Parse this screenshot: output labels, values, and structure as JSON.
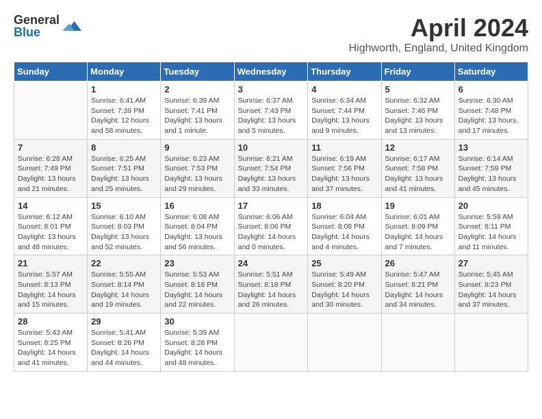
{
  "logo": {
    "general": "General",
    "blue": "Blue"
  },
  "title": "April 2024",
  "location": "Highworth, England, United Kingdom",
  "days_of_week": [
    "Sunday",
    "Monday",
    "Tuesday",
    "Wednesday",
    "Thursday",
    "Friday",
    "Saturday"
  ],
  "weeks": [
    [
      {
        "day": "",
        "sunrise": "",
        "sunset": "",
        "daylight": ""
      },
      {
        "day": "1",
        "sunrise": "Sunrise: 6:41 AM",
        "sunset": "Sunset: 7:39 PM",
        "daylight": "Daylight: 12 hours and 58 minutes."
      },
      {
        "day": "2",
        "sunrise": "Sunrise: 6:39 AM",
        "sunset": "Sunset: 7:41 PM",
        "daylight": "Daylight: 13 hours and 1 minute."
      },
      {
        "day": "3",
        "sunrise": "Sunrise: 6:37 AM",
        "sunset": "Sunset: 7:43 PM",
        "daylight": "Daylight: 13 hours and 5 minutes."
      },
      {
        "day": "4",
        "sunrise": "Sunrise: 6:34 AM",
        "sunset": "Sunset: 7:44 PM",
        "daylight": "Daylight: 13 hours and 9 minutes."
      },
      {
        "day": "5",
        "sunrise": "Sunrise: 6:32 AM",
        "sunset": "Sunset: 7:46 PM",
        "daylight": "Daylight: 13 hours and 13 minutes."
      },
      {
        "day": "6",
        "sunrise": "Sunrise: 6:30 AM",
        "sunset": "Sunset: 7:48 PM",
        "daylight": "Daylight: 13 hours and 17 minutes."
      }
    ],
    [
      {
        "day": "7",
        "sunrise": "Sunrise: 6:28 AM",
        "sunset": "Sunset: 7:49 PM",
        "daylight": "Daylight: 13 hours and 21 minutes."
      },
      {
        "day": "8",
        "sunrise": "Sunrise: 6:25 AM",
        "sunset": "Sunset: 7:51 PM",
        "daylight": "Daylight: 13 hours and 25 minutes."
      },
      {
        "day": "9",
        "sunrise": "Sunrise: 6:23 AM",
        "sunset": "Sunset: 7:53 PM",
        "daylight": "Daylight: 13 hours and 29 minutes."
      },
      {
        "day": "10",
        "sunrise": "Sunrise: 6:21 AM",
        "sunset": "Sunset: 7:54 PM",
        "daylight": "Daylight: 13 hours and 33 minutes."
      },
      {
        "day": "11",
        "sunrise": "Sunrise: 6:19 AM",
        "sunset": "Sunset: 7:56 PM",
        "daylight": "Daylight: 13 hours and 37 minutes."
      },
      {
        "day": "12",
        "sunrise": "Sunrise: 6:17 AM",
        "sunset": "Sunset: 7:58 PM",
        "daylight": "Daylight: 13 hours and 41 minutes."
      },
      {
        "day": "13",
        "sunrise": "Sunrise: 6:14 AM",
        "sunset": "Sunset: 7:59 PM",
        "daylight": "Daylight: 13 hours and 45 minutes."
      }
    ],
    [
      {
        "day": "14",
        "sunrise": "Sunrise: 6:12 AM",
        "sunset": "Sunset: 8:01 PM",
        "daylight": "Daylight: 13 hours and 48 minutes."
      },
      {
        "day": "15",
        "sunrise": "Sunrise: 6:10 AM",
        "sunset": "Sunset: 8:03 PM",
        "daylight": "Daylight: 13 hours and 52 minutes."
      },
      {
        "day": "16",
        "sunrise": "Sunrise: 6:08 AM",
        "sunset": "Sunset: 8:04 PM",
        "daylight": "Daylight: 13 hours and 56 minutes."
      },
      {
        "day": "17",
        "sunrise": "Sunrise: 6:06 AM",
        "sunset": "Sunset: 8:06 PM",
        "daylight": "Daylight: 14 hours and 0 minutes."
      },
      {
        "day": "18",
        "sunrise": "Sunrise: 6:04 AM",
        "sunset": "Sunset: 8:08 PM",
        "daylight": "Daylight: 14 hours and 4 minutes."
      },
      {
        "day": "19",
        "sunrise": "Sunrise: 6:01 AM",
        "sunset": "Sunset: 8:09 PM",
        "daylight": "Daylight: 14 hours and 7 minutes."
      },
      {
        "day": "20",
        "sunrise": "Sunrise: 5:59 AM",
        "sunset": "Sunset: 8:11 PM",
        "daylight": "Daylight: 14 hours and 11 minutes."
      }
    ],
    [
      {
        "day": "21",
        "sunrise": "Sunrise: 5:57 AM",
        "sunset": "Sunset: 8:13 PM",
        "daylight": "Daylight: 14 hours and 15 minutes."
      },
      {
        "day": "22",
        "sunrise": "Sunrise: 5:55 AM",
        "sunset": "Sunset: 8:14 PM",
        "daylight": "Daylight: 14 hours and 19 minutes."
      },
      {
        "day": "23",
        "sunrise": "Sunrise: 5:53 AM",
        "sunset": "Sunset: 8:16 PM",
        "daylight": "Daylight: 14 hours and 22 minutes."
      },
      {
        "day": "24",
        "sunrise": "Sunrise: 5:51 AM",
        "sunset": "Sunset: 8:18 PM",
        "daylight": "Daylight: 14 hours and 26 minutes."
      },
      {
        "day": "25",
        "sunrise": "Sunrise: 5:49 AM",
        "sunset": "Sunset: 8:20 PM",
        "daylight": "Daylight: 14 hours and 30 minutes."
      },
      {
        "day": "26",
        "sunrise": "Sunrise: 5:47 AM",
        "sunset": "Sunset: 8:21 PM",
        "daylight": "Daylight: 14 hours and 34 minutes."
      },
      {
        "day": "27",
        "sunrise": "Sunrise: 5:45 AM",
        "sunset": "Sunset: 8:23 PM",
        "daylight": "Daylight: 14 hours and 37 minutes."
      }
    ],
    [
      {
        "day": "28",
        "sunrise": "Sunrise: 5:43 AM",
        "sunset": "Sunset: 8:25 PM",
        "daylight": "Daylight: 14 hours and 41 minutes."
      },
      {
        "day": "29",
        "sunrise": "Sunrise: 5:41 AM",
        "sunset": "Sunset: 8:26 PM",
        "daylight": "Daylight: 14 hours and 44 minutes."
      },
      {
        "day": "30",
        "sunrise": "Sunrise: 5:39 AM",
        "sunset": "Sunset: 8:28 PM",
        "daylight": "Daylight: 14 hours and 48 minutes."
      },
      {
        "day": "",
        "sunrise": "",
        "sunset": "",
        "daylight": ""
      },
      {
        "day": "",
        "sunrise": "",
        "sunset": "",
        "daylight": ""
      },
      {
        "day": "",
        "sunrise": "",
        "sunset": "",
        "daylight": ""
      },
      {
        "day": "",
        "sunrise": "",
        "sunset": "",
        "daylight": ""
      }
    ]
  ]
}
